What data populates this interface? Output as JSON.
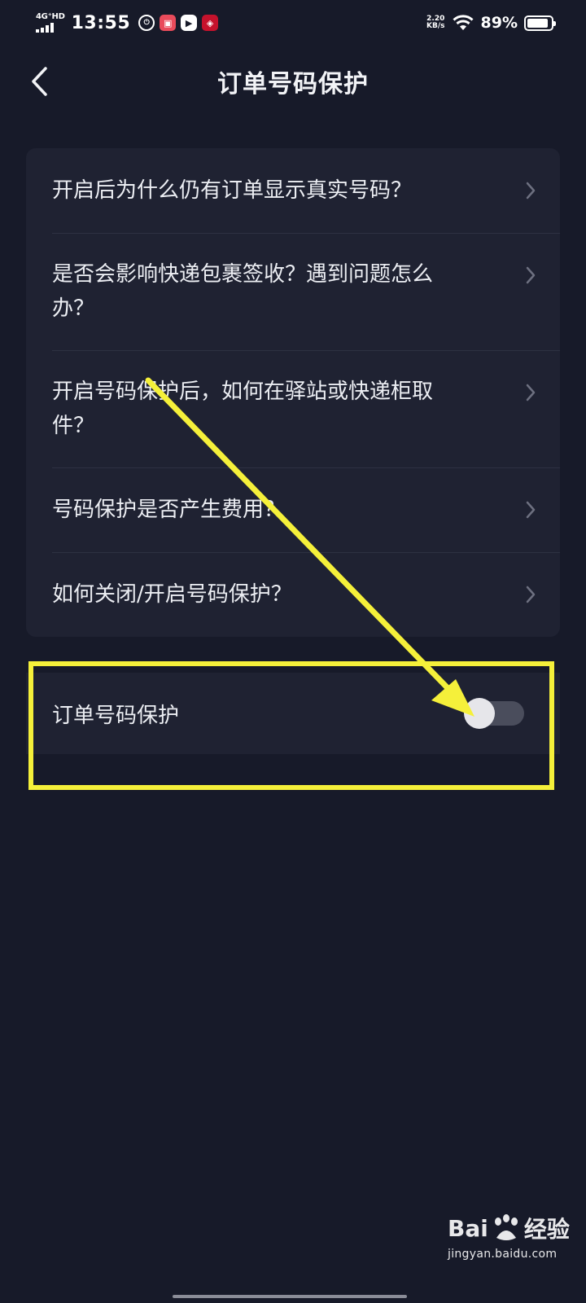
{
  "status_bar": {
    "network": "4G⁺HD",
    "time": "13:55",
    "notif_icons": [
      "clock-icon",
      "app-icon-pink",
      "play-icon",
      "app-icon-red"
    ],
    "speed_value": "2.20",
    "speed_unit": "KB/s",
    "battery_pct": "89%",
    "battery_level": 0.89
  },
  "header": {
    "title": "订单号码保护"
  },
  "faq": {
    "items": [
      {
        "label": "开启后为什么仍有订单显示真实号码？"
      },
      {
        "label": "是否会影响快递包裹签收？遇到问题怎么办？"
      },
      {
        "label": "开启号码保护后，如何在驿站或快递柜取件？"
      },
      {
        "label": "号码保护是否产生费用？"
      },
      {
        "label": "如何关闭/开启号码保护？"
      }
    ]
  },
  "setting": {
    "label": "订单号码保护",
    "enabled": false
  },
  "annotation": {
    "highlight_color": "#f5f03a"
  },
  "watermark": {
    "left": "Bai",
    "right": "经验",
    "url": "jingyan.baidu.com"
  },
  "colors": {
    "background": "#171a29",
    "card": "#1f2232",
    "text": "#eceef3",
    "switch_off_track": "#4a4d5c"
  }
}
